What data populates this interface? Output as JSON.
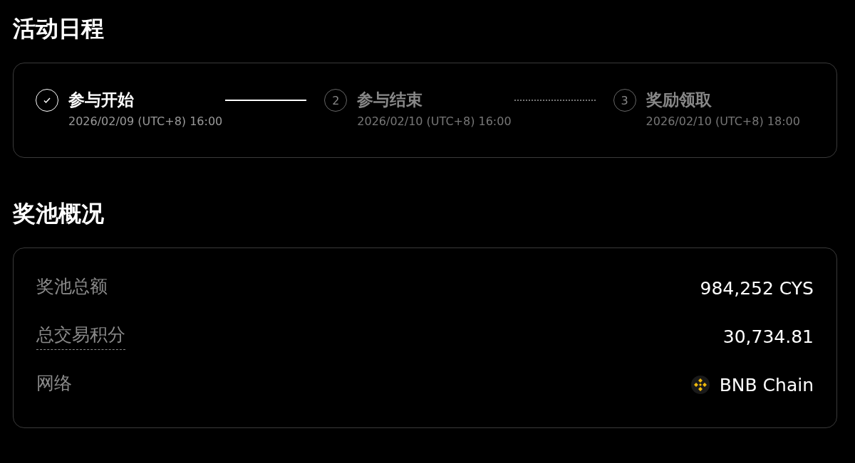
{
  "schedule": {
    "title": "活动日程",
    "steps": [
      {
        "label": "参与开始",
        "date": "2026/02/09 (UTC+8) 16:00",
        "done": true
      },
      {
        "number": "2",
        "label": "参与结束",
        "date": "2026/02/10 (UTC+8) 16:00",
        "done": false
      },
      {
        "number": "3",
        "label": "奖励领取",
        "date": "2026/02/10 (UTC+8) 18:00",
        "done": false
      }
    ]
  },
  "pool": {
    "title": "奖池概况",
    "rows": [
      {
        "label": "奖池总额",
        "value": "984,252 CYS",
        "kind": "plain"
      },
      {
        "label": "总交易积分",
        "value": "30,734.81",
        "kind": "tooltip"
      },
      {
        "label": "网络",
        "value": "BNB Chain",
        "kind": "network"
      }
    ]
  }
}
